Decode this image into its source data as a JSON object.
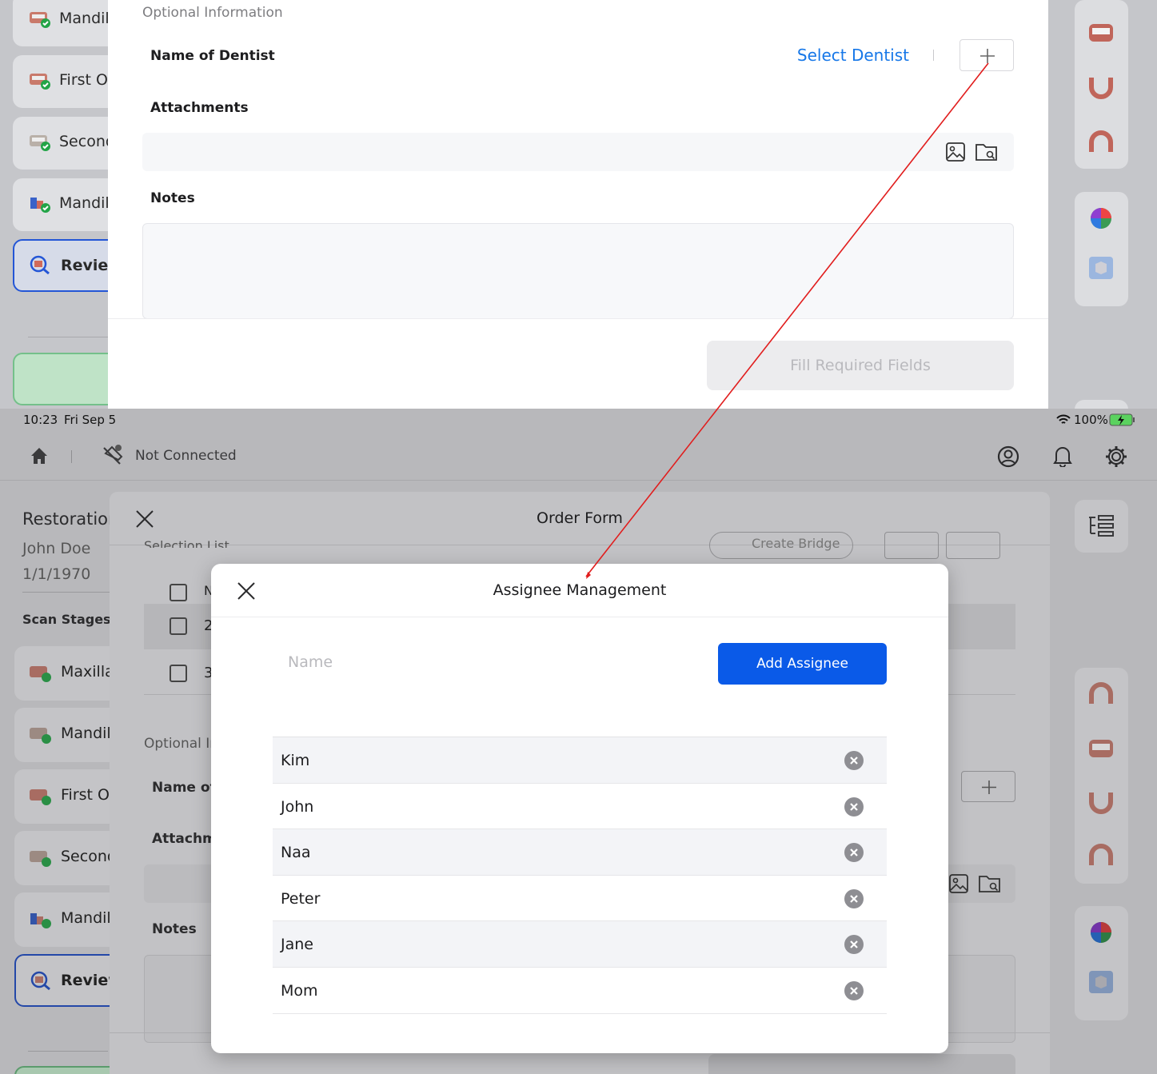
{
  "top_panel": {
    "left_nav": [
      {
        "label": "Mandil",
        "icon": "jaw-check-icon"
      },
      {
        "label": "First O",
        "icon": "jaw-check-icon"
      },
      {
        "label": "Second",
        "icon": "jaw-check-icon"
      },
      {
        "label": "Mandil",
        "icon": "bite-check-icon"
      },
      {
        "label": "Review",
        "icon": "review-icon",
        "active": true
      }
    ],
    "form": {
      "section_title": "Optional Information",
      "dentist_label": "Name of Dentist",
      "select_dentist": "Select Dentist",
      "attachments_label": "Attachments",
      "notes_label": "Notes",
      "fill_button": "Fill Required Fields"
    }
  },
  "status_bar": {
    "time": "10:23",
    "date": "Fri Sep 5",
    "battery": "100%"
  },
  "top_nav": {
    "connection": "Not Connected"
  },
  "background": {
    "restoration_title": "Restoration",
    "patient_name": "John Doe",
    "patient_dob": "1/1/1970",
    "scan_stages": "Scan Stages (",
    "selection_list": "Selection List",
    "create_bridge": "Create Bridge",
    "rows": [
      "N",
      "2",
      "3"
    ],
    "nav": [
      "Maxilla",
      "Mandil",
      "First O",
      "Second",
      "Mandil",
      "Review"
    ],
    "optional_info": "Optional In",
    "dentist_label": "Name of",
    "attachments_label": "Attachme",
    "notes_label": "Notes"
  },
  "order_form": {
    "title": "Order Form"
  },
  "modal": {
    "title": "Assignee Management",
    "name_placeholder": "Name",
    "add_button": "Add Assignee",
    "assignees": [
      "Kim",
      "John",
      "Naa",
      "Peter",
      "Jane",
      "Mom"
    ]
  },
  "colors": {
    "accent_blue": "#0a5ae8",
    "link_blue": "#1677e8",
    "annotation_red": "#e11d1d",
    "active_border": "#2456d6"
  }
}
